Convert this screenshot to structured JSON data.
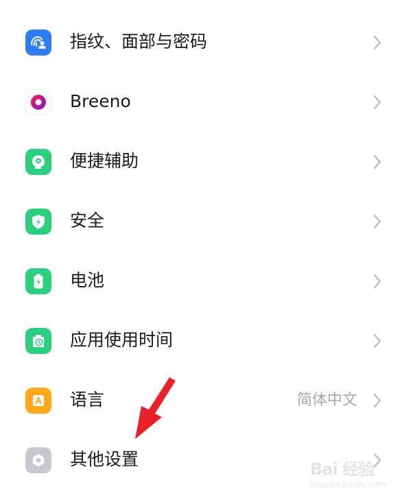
{
  "settings": {
    "items": [
      {
        "label": "指纹、面部与密码",
        "icon": "fingerprint-face-icon",
        "icon_color": "#2f7df6"
      },
      {
        "label": "Breeno",
        "icon": "breeno-icon",
        "icon_color": "#e6007e"
      },
      {
        "label": "便捷辅助",
        "icon": "convenience-assist-icon",
        "icon_color": "#2ccf7f"
      },
      {
        "label": "安全",
        "icon": "security-shield-icon",
        "icon_color": "#2ccf7f"
      },
      {
        "label": "电池",
        "icon": "battery-icon",
        "icon_color": "#2ccf7f"
      },
      {
        "label": "应用使用时间",
        "icon": "app-usage-time-icon",
        "icon_color": "#2ccf7f"
      },
      {
        "label": "语言",
        "value": "简体中文",
        "icon": "language-icon",
        "icon_color": "#ffa81e"
      },
      {
        "label": "其他设置",
        "icon": "other-settings-icon",
        "icon_color": "#c7c9cf"
      }
    ]
  },
  "annotation": {
    "arrow_color": "#e8202a"
  },
  "watermark": {
    "logo": "Bai 经验",
    "url": "jingyan.baidu.com"
  }
}
